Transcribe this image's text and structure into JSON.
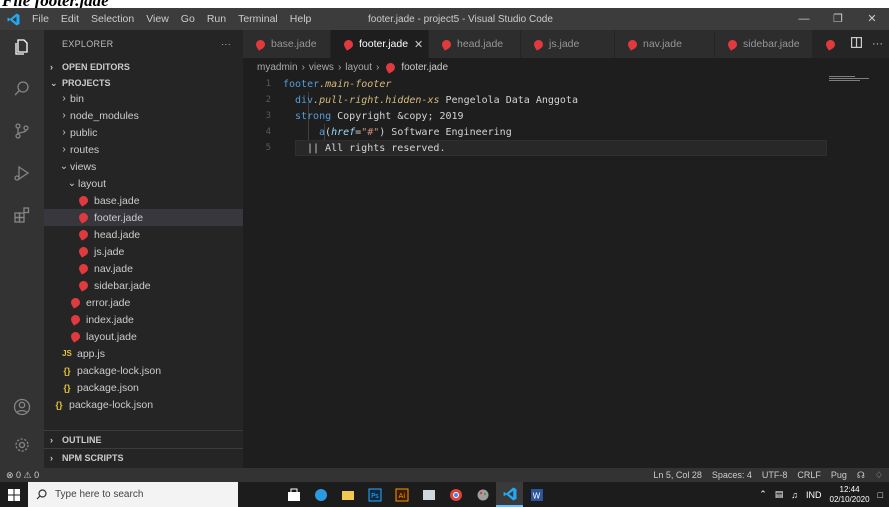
{
  "caption": "File footer.jade",
  "titlebar": {
    "menu": [
      "File",
      "Edit",
      "Selection",
      "View",
      "Go",
      "Run",
      "Terminal",
      "Help"
    ],
    "window_title": "footer.jade - project5 - Visual Studio Code"
  },
  "sidebar": {
    "header": "EXPLORER",
    "more": "···",
    "open_editors": "OPEN EDITORS",
    "projects": "PROJECTS",
    "tree": [
      {
        "label": "bin",
        "depth": 1,
        "kind": "folder",
        "open": false
      },
      {
        "label": "node_modules",
        "depth": 1,
        "kind": "folder",
        "open": false
      },
      {
        "label": "public",
        "depth": 1,
        "kind": "folder",
        "open": false
      },
      {
        "label": "routes",
        "depth": 1,
        "kind": "folder",
        "open": false
      },
      {
        "label": "views",
        "depth": 1,
        "kind": "folder",
        "open": true
      },
      {
        "label": "layout",
        "depth": 2,
        "kind": "folder",
        "open": true
      },
      {
        "label": "base.jade",
        "depth": 3,
        "kind": "jade"
      },
      {
        "label": "footer.jade",
        "depth": 3,
        "kind": "jade",
        "selected": true
      },
      {
        "label": "head.jade",
        "depth": 3,
        "kind": "jade"
      },
      {
        "label": "js.jade",
        "depth": 3,
        "kind": "jade"
      },
      {
        "label": "nav.jade",
        "depth": 3,
        "kind": "jade"
      },
      {
        "label": "sidebar.jade",
        "depth": 3,
        "kind": "jade"
      },
      {
        "label": "error.jade",
        "depth": 2,
        "kind": "jade"
      },
      {
        "label": "index.jade",
        "depth": 2,
        "kind": "jade"
      },
      {
        "label": "layout.jade",
        "depth": 2,
        "kind": "jade"
      },
      {
        "label": "app.js",
        "depth": 1,
        "kind": "js"
      },
      {
        "label": "package-lock.json",
        "depth": 1,
        "kind": "json"
      },
      {
        "label": "package.json",
        "depth": 1,
        "kind": "json"
      },
      {
        "label": "package-lock.json",
        "depth": 0,
        "kind": "json"
      }
    ],
    "outline": "OUTLINE",
    "npm_scripts": "NPM SCRIPTS"
  },
  "tabs": [
    {
      "label": "base.jade",
      "active": false
    },
    {
      "label": "footer.jade",
      "active": true,
      "close": "✕"
    },
    {
      "label": "head.jade",
      "active": false
    },
    {
      "label": "js.jade",
      "active": false
    },
    {
      "label": "nav.jade",
      "active": false
    },
    {
      "label": "sidebar.jade",
      "active": false
    }
  ],
  "breadcrumb": [
    "myadmin",
    "views",
    "layout",
    "footer.jade"
  ],
  "code": {
    "line_numbers": [
      "1",
      "2",
      "3",
      "4",
      "5"
    ],
    "l1_tag": "footer",
    "l1_class": ".main-footer",
    "l2_tag": "div",
    "l2_class": ".pull-right.hidden-xs",
    "l2_text": " Pengelola Data Anggota",
    "l3_tag": "strong",
    "l3_text": " Copyright &copy; 2019",
    "l4_tag": "a",
    "l4_open": "(",
    "l4_attr": "href",
    "l4_eq": "=",
    "l4_val": "\"#\"",
    "l4_close": ")",
    "l4_text": " Software Engineering",
    "l5_text": "|| All rights reserved."
  },
  "statusbar": {
    "errors": "⊗ 0 ⚠ 0",
    "position": "Ln 5, Col 28",
    "spaces": "Spaces: 4",
    "encoding": "UTF-8",
    "eol": "CRLF",
    "language": "Pug"
  },
  "taskbar": {
    "search_placeholder": "Type here to search",
    "lang": "IND",
    "time": "12:44",
    "date": "02/10/2020"
  },
  "colors": {
    "accent_blue": "#23a9f2",
    "jade_red": "#e03a3e"
  }
}
